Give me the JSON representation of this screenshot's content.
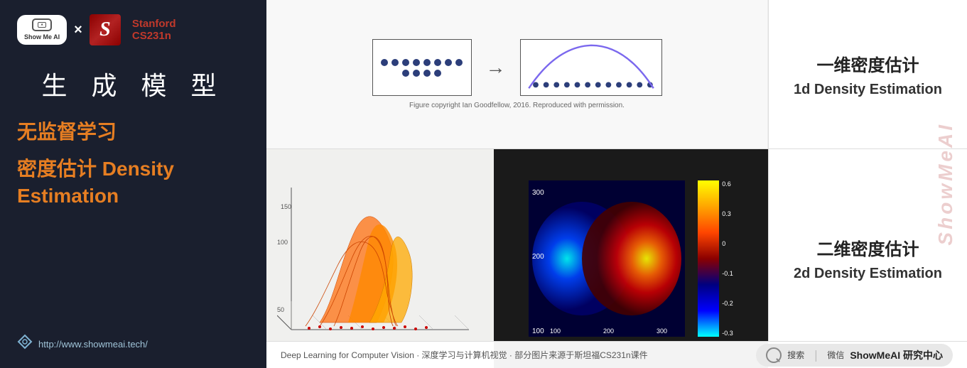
{
  "left": {
    "logo": {
      "showmeai_label": "Show Me AI",
      "cross": "×",
      "stanford_s": "S",
      "stanford_name": "Stanford",
      "stanford_course": "CS231n"
    },
    "main_title": "生 成 模 型",
    "subtitle1": "无监督学习",
    "subtitle2_line1": "密度估计 Density",
    "subtitle2_line2": "Estimation",
    "url": "http://www.showmeai.tech/"
  },
  "right": {
    "top": {
      "diagram_caption": "Figure copyright Ian Goodfellow, 2016. Reproduced with permission.",
      "label_cn": "一维密度估计",
      "label_en": "1d Density Estimation"
    },
    "bottom": {
      "label_cn": "二维密度估计",
      "label_en": "2d Density Estimation",
      "colorbar_values": [
        "0.6",
        "0.3",
        "0",
        "-0.1",
        "-0.2",
        "-0.3"
      ]
    },
    "footer": {
      "left_text": "Deep Learning for Computer Vision · 深度学习与计算机视觉 · 部分图片来源于斯坦福CS231n课件",
      "search_label": "搜索",
      "divider": "｜",
      "wechat_label": "微信",
      "brand": "ShowMeAI 研究中心"
    },
    "watermark": "ShowMeAI"
  }
}
